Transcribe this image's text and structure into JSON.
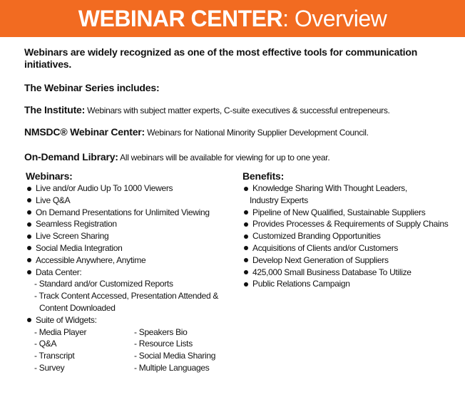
{
  "banner": {
    "title_bold": "WEBINAR CENTER",
    "title_rest": ": Overview",
    "color": "#f26b21"
  },
  "intro": "Webinars are widely recognized as one of the most effective tools for communication initiatives.",
  "series_heading": "The Webinar Series includes:",
  "series": [
    {
      "name": "The Institute:",
      "desc": "Webinars with subject matter experts, C-suite executives & successful entrepeneurs."
    },
    {
      "name": "NMSDC® Webinar Center:",
      "desc": "Webinars for National Minority Supplier Development Council."
    },
    {
      "name": "On-Demand Library:",
      "desc": "All webinars will be available for viewing for up to one year."
    }
  ],
  "webinars": {
    "heading": "Webinars:",
    "items": [
      "Live and/or Audio Up To 1000 Viewers",
      "Live Q&A",
      "On Demand Presentations for Unlimited Viewing",
      "Seamless Registration",
      "Live Screen Sharing",
      "Social Media Integration",
      "Accessible Anywhere, Anytime",
      "Data Center:"
    ],
    "data_center": [
      "Standard and/or Customized Reports",
      "Track Content Accessed, Presentation Attended &"
    ],
    "data_center_cont": "Content Downloaded",
    "suite_label": "Suite of Widgets:",
    "widgets_left": [
      "Media Player",
      "Q&A",
      "Transcript",
      "Survey"
    ],
    "widgets_right": [
      "Speakers Bio",
      "Resource Lists",
      "Social Media Sharing",
      "Multiple Languages"
    ]
  },
  "benefits": {
    "heading": "Benefits:",
    "first": "Knowledge Sharing With Thought Leaders,",
    "first_cont": "Industry Experts",
    "items": [
      "Pipeline of New Qualified, Sustainable Suppliers",
      "Provides Processes & Requirements of Supply Chains",
      "Customized Branding Opportunities",
      "Acquisitions of Clients and/or Customers",
      "Develop Next Generation of Suppliers",
      "425,000 Small Business Database To Utilize",
      "Public Relations Campaign"
    ]
  }
}
